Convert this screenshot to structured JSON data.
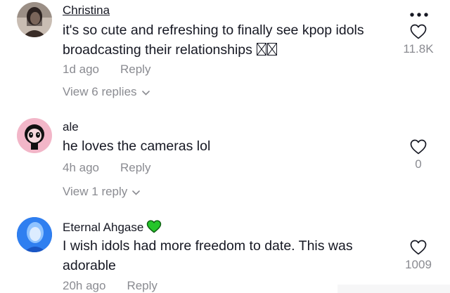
{
  "comments": [
    {
      "username": "Christina",
      "text": "it's so cute and refreshing to finally see kpop idols broadcasting their relationships",
      "time": "1d ago",
      "reply_label": "Reply",
      "likes": "11.8K",
      "view_replies": "View 6 replies",
      "avatar_icon": "profile-photo",
      "trailing_emoji": "unsupported-glyph-boxes"
    },
    {
      "username": "ale",
      "text": "he loves the cameras lol",
      "time": "4h ago",
      "reply_label": "Reply",
      "likes": "0",
      "view_replies": "View 1 reply",
      "avatar_icon": "cartoon-character-avatar"
    },
    {
      "username": "Eternal Ahgase",
      "username_badge": "green-heart-emoji",
      "text": "I wish idols had more freedom to date. This was adorable",
      "time": "20h ago",
      "reply_label": "Reply",
      "likes": "1009",
      "avatar_icon": "blue-toned-profile-photo"
    }
  ],
  "colors": {
    "primary_text": "#161823",
    "secondary_text": "#8a8b91",
    "badge_green": "#25c52a"
  },
  "icons": {
    "more": "more-options-icon",
    "like": "heart-outline-icon",
    "chevron": "chevron-down-icon"
  }
}
